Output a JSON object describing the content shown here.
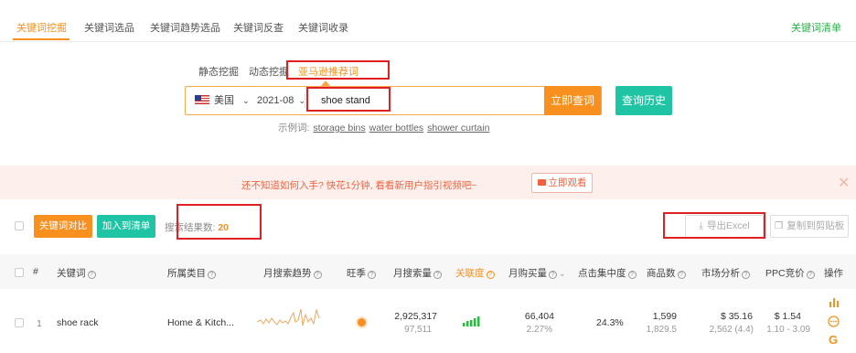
{
  "top_tabs": [
    {
      "label": "关键词挖掘"
    },
    {
      "label": "关键词选品"
    },
    {
      "label": "关键词趋势选品"
    },
    {
      "label": "关键词反查"
    },
    {
      "label": "关键词收录"
    }
  ],
  "keyword_list_link": "关键词清单",
  "modes": [
    {
      "label": "静态挖掘"
    },
    {
      "label": "动态挖掘"
    },
    {
      "label": "亚马逊推荐词"
    }
  ],
  "search": {
    "country": "美国",
    "month": "2021-08",
    "query": "shoe stand",
    "submit_label": "立即查词",
    "history_label": "查询历史"
  },
  "examples": {
    "label": "示例词:",
    "items": [
      "storage bins",
      "water bottles",
      "shower curtain"
    ]
  },
  "banner": {
    "text": "还不知道如何入手? 快花1分钟, 看看新用户指引视频吧~",
    "watch_label": "立即观看",
    "close": "✕"
  },
  "actions": {
    "compare_label": "关键词对比",
    "add_list_label": "加入到清单",
    "result_label": "搜索结果数:",
    "result_count": "20",
    "export_label": "导出Excel",
    "copy_label": "复制到剪贴板"
  },
  "table": {
    "headers": {
      "index": "#",
      "keyword": "关键词",
      "category": "所属类目",
      "trend": "月搜索趋势",
      "season": "旺季",
      "search_volume": "月搜索量",
      "relevance": "关联度",
      "purchases": "月购买量",
      "click_conc": "点击集中度",
      "products": "商品数",
      "market": "市场分析",
      "ppc": "PPC竞价",
      "ops": "操作"
    },
    "rows": [
      {
        "index": "1",
        "keyword": "shoe rack",
        "category": "Home & Kitch...",
        "search_volume": "2,925,317",
        "search_sub": "97,511",
        "purchases": "66,404",
        "purchases_pct": "2.27%",
        "click_conc": "24.3%",
        "products": "1,599",
        "products_sub": "1,829.5",
        "market_price": "$ 35.16",
        "market_sub": "2,562 (4.4)",
        "ppc": "$ 1.54",
        "ppc_range": "1.10 - 3.09"
      }
    ]
  },
  "colors": {
    "accent_orange": "#f7901e",
    "accent_green": "#1ec4a4",
    "highlight_red": "#e02020",
    "banner_text": "#f0623f"
  }
}
